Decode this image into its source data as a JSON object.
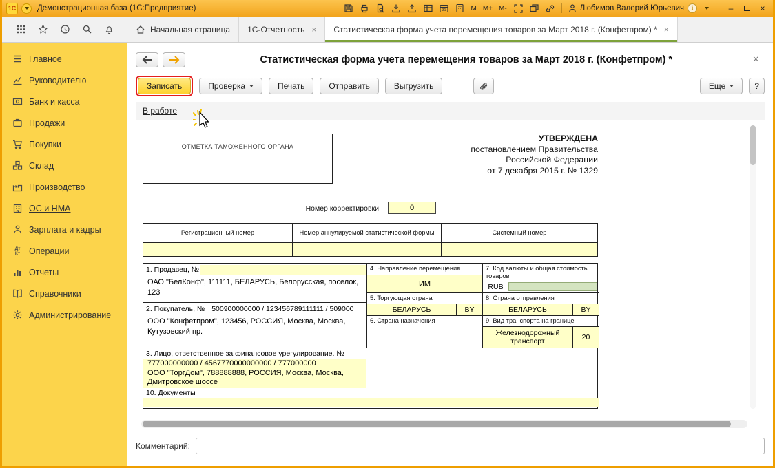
{
  "titlebar": {
    "logo": "1С",
    "title": "Демонстрационная база  (1С:Предприятие)",
    "calendar_day": "31",
    "memory": {
      "m": "M",
      "m_plus": "M+",
      "m_minus": "M-"
    },
    "user_name": "Любимов Валерий Юрьевич",
    "info_glyph": "i",
    "controls": {
      "minimize": "–",
      "close": "×"
    }
  },
  "tabbar": {
    "tabs": [
      {
        "label": "Начальная страница"
      },
      {
        "label": "1С-Отчетность",
        "close": "×"
      },
      {
        "label": "Статистическая форма учета перемещения товаров за Март 2018 г. (Конфетпром) *",
        "close": "×"
      }
    ]
  },
  "sidebar": {
    "items": [
      {
        "label": "Главное"
      },
      {
        "label": "Руководителю"
      },
      {
        "label": "Банк и касса"
      },
      {
        "label": "Продажи"
      },
      {
        "label": "Покупки"
      },
      {
        "label": "Склад"
      },
      {
        "label": "Производство"
      },
      {
        "label": "ОС и НМА"
      },
      {
        "label": "Зарплата и кадры"
      },
      {
        "label": "Операции",
        "icon_line1": "Дт",
        "icon_line2": "Кт"
      },
      {
        "label": "Отчеты"
      },
      {
        "label": "Справочники"
      },
      {
        "label": "Администрирование"
      }
    ]
  },
  "page": {
    "title": "Статистическая форма учета перемещения товаров за Март 2018 г. (Конфетпром) *",
    "close": "×",
    "toolbar": {
      "save": "Записать",
      "check": "Проверка",
      "print": "Печать",
      "send": "Отправить",
      "upload": "Выгрузить",
      "more": "Еще",
      "help": "?"
    },
    "status_link": "В работе",
    "comment_label": "Комментарий:"
  },
  "form": {
    "customs_mark": "ОТМЕТКА ТАМОЖЕННОГО ОРГАНА",
    "approved_lines": [
      "УТВЕРЖДЕНА",
      "постановлением Правительства",
      "Российской Федерации",
      "от 7 декабря 2015 г. № 1329"
    ],
    "correction": {
      "label": "Номер корректировки",
      "value": "0"
    },
    "registration": {
      "col1": "Регистрационный номер",
      "col2": "Номер аннулируемой статистической формы",
      "col3": "Системный номер"
    },
    "seller": {
      "label": "1. Продавец, №",
      "text": "ОАО \"БелКонф\", 111111, БЕЛАРУСЬ, Белорусская, поселок, 123"
    },
    "buyer": {
      "label": "2. Покупатель, №",
      "number": "500900000000 / 123456789111111 / 509000",
      "text": "ООО \"Конфетпром\", 123456, РОССИЯ, Москва, Москва, Кутузовский пр."
    },
    "person": {
      "label": "3. Лицо, ответственное за финансовое урегулирование. №",
      "number": "777000000000 / 4567770000000000 / 777000000",
      "text": "ООО \"ТоргДом\", 788888888, РОССИЯ, Москва, Москва, Дмитровское шоссе"
    },
    "direction": {
      "label": "4. Направление перемещения",
      "value": "ИМ"
    },
    "trading": {
      "label": "5. Торгующая страна",
      "value": "БЕЛАРУСЬ",
      "code": "BY"
    },
    "destination": {
      "label": "6. Страна назначения"
    },
    "currency": {
      "label": "7. Код валюты и общая стоимость товаров",
      "value": "RUB"
    },
    "departure": {
      "label": "8. Страна отправления",
      "value": "БЕЛАРУСЬ",
      "code": "BY"
    },
    "transport": {
      "label": "9. Вид транспорта на границе",
      "value": "Железнодорожный транспорт",
      "code": "20"
    },
    "documents": {
      "label": "10. Документы"
    }
  }
}
